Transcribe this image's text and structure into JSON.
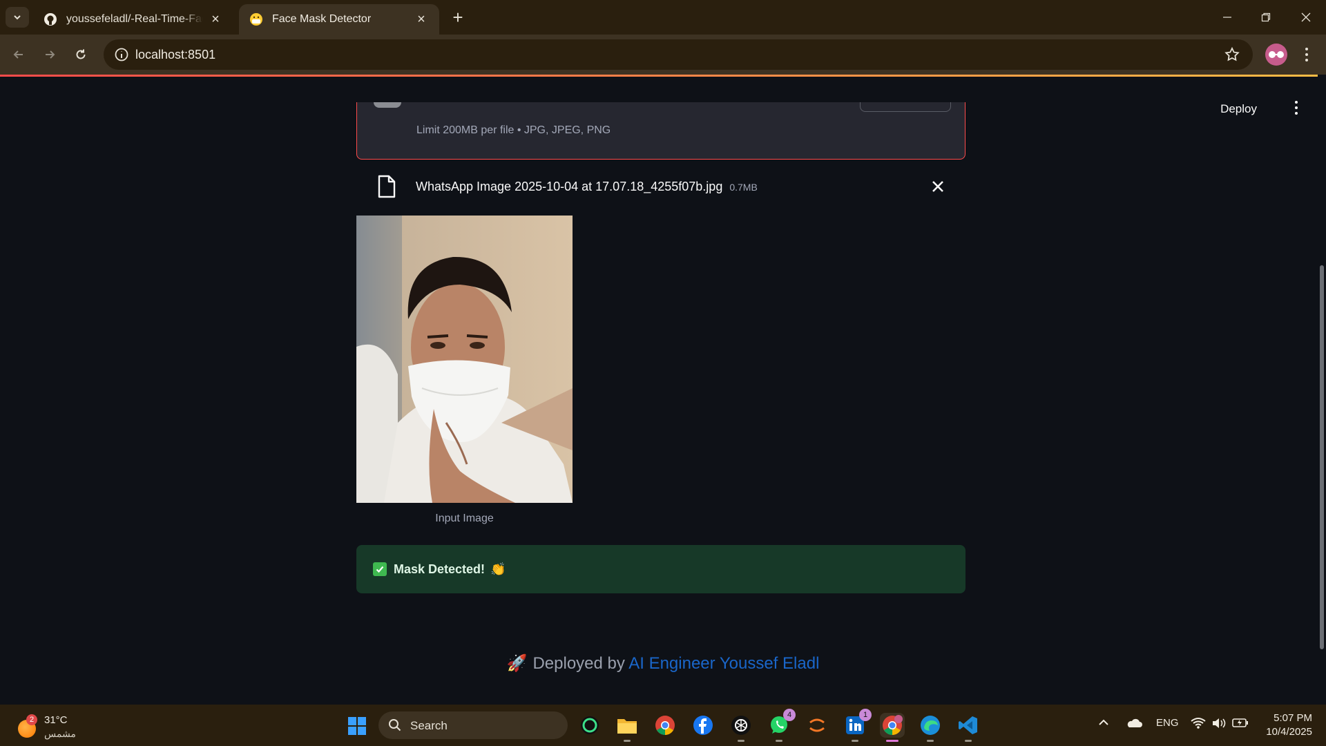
{
  "browser": {
    "tabs": [
      {
        "title": "youssefeladl/-Real-Time-Face-Mask-Detection",
        "favicon": "github-icon",
        "active": false
      },
      {
        "title": "Face Mask Detector",
        "favicon": "mask-face-emoji-icon",
        "active": true
      }
    ],
    "url": "localhost:8501"
  },
  "streamlit": {
    "deploy_label": "Deploy",
    "uploader": {
      "limit_text": "Limit 200MB per file • JPG, JPEG, PNG"
    },
    "file": {
      "name": "WhatsApp Image 2025-10-04 at 17.07.18_4255f07b.jpg",
      "size": "0.7MB"
    },
    "image_caption": "Input Image",
    "result": {
      "message": "Mask Detected!",
      "emoji": "👏",
      "color": "#173928"
    },
    "footer": {
      "prefix": "Deployed by",
      "author": "AI Engineer Youssef Eladl",
      "emoji": "🚀",
      "link_color": "#1a66c9"
    }
  },
  "taskbar": {
    "weather": {
      "badge": "2",
      "temp": "31°C",
      "condition": "مشمس"
    },
    "search_label": "Search",
    "apps": [
      {
        "name": "obs-icon",
        "badge": ""
      },
      {
        "name": "file-explorer-icon",
        "badge": ""
      },
      {
        "name": "chrome-icon",
        "badge": ""
      },
      {
        "name": "facebook-icon",
        "badge": ""
      },
      {
        "name": "chatgpt-icon",
        "badge": ""
      },
      {
        "name": "whatsapp-icon",
        "badge": "4"
      },
      {
        "name": "jupyter-icon",
        "badge": ""
      },
      {
        "name": "linkedin-icon",
        "badge": "1"
      },
      {
        "name": "chrome-profile-icon",
        "badge": ""
      },
      {
        "name": "edge-icon",
        "badge": ""
      },
      {
        "name": "vscode-icon",
        "badge": ""
      }
    ],
    "language": "ENG",
    "time": "5:07 PM",
    "date": "10/4/2025"
  }
}
